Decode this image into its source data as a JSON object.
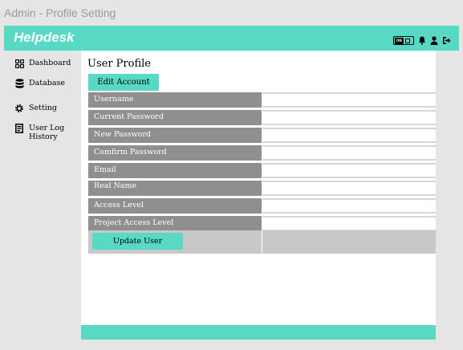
{
  "window": {
    "title": "Admin - Profile Setting"
  },
  "header": {
    "brand": "Helpdesk",
    "toggle_text": "ON"
  },
  "sidebar": {
    "items": [
      {
        "label": "Dashboard",
        "icon": "dashboard-icon"
      },
      {
        "label": "Database",
        "icon": "database-icon"
      },
      {
        "label": "Setting",
        "icon": "gear-icon"
      },
      {
        "label": "User Log History",
        "icon": "log-icon"
      }
    ]
  },
  "main": {
    "title": "User Profile",
    "tab_label": "Edit Account",
    "fields": [
      {
        "label": "Username",
        "value": ""
      },
      {
        "label": "Current Password",
        "value": ""
      },
      {
        "label": "New Password",
        "value": ""
      },
      {
        "label": "Comfirm Password",
        "value": ""
      },
      {
        "label": "Email",
        "value": ""
      },
      {
        "label": "Real Name",
        "value": ""
      },
      {
        "label": "Access Level",
        "value": ""
      },
      {
        "label": "Project Access Level",
        "value": ""
      }
    ],
    "update_button": "Update User"
  },
  "colors": {
    "accent": "#58d9c4",
    "label_bg": "#8f8f8f",
    "page_bg": "#e5e5e5"
  }
}
